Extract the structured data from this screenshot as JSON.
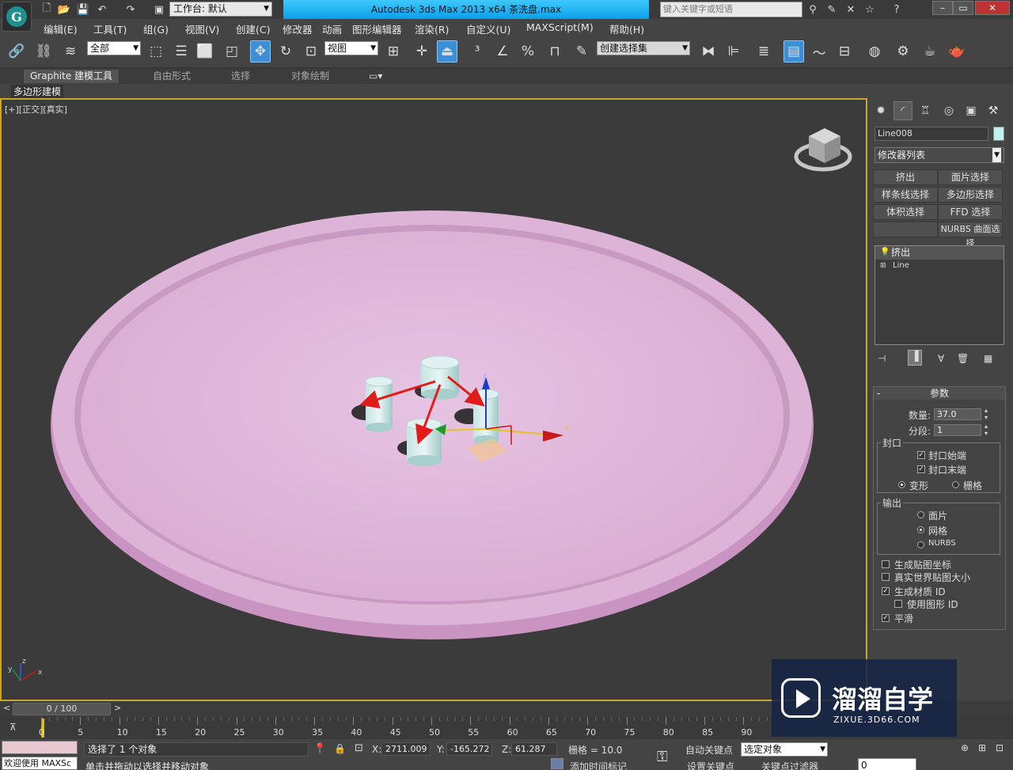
{
  "titlebar": {
    "workspace": "工作台: 默认",
    "app_title": "Autodesk 3ds Max  2013 x64      茶洗盘.max",
    "search_placeholder": "键入关键字或短语"
  },
  "menu": [
    "编辑(E)",
    "工具(T)",
    "组(G)",
    "视图(V)",
    "创建(C)",
    "修改器",
    "动画",
    "图形编辑器",
    "渲染(R)",
    "自定义(U)",
    "MAXScript(M)",
    "帮助(H)"
  ],
  "toolbar": {
    "selection_filter": "全部",
    "ref_coord": "视图",
    "named_selection": "创建选择集"
  },
  "ribbon": {
    "tabs": [
      "Graphite 建模工具",
      "自由形式",
      "选择",
      "对象绘制"
    ],
    "panel": "多边形建模"
  },
  "viewport": {
    "label": "[+][正交][真实]",
    "axis_labels": [
      "x",
      "y",
      "z"
    ]
  },
  "command_panel": {
    "object_name": "Line008",
    "object_color": "#bff2ee",
    "modifier_list": "修改器列表",
    "mod_buttons": [
      "挤出",
      "面片选择",
      "样条线选择",
      "多边形选择",
      "体积选择",
      "FFD 选择",
      "",
      "NURBS 曲面选择"
    ],
    "stack": [
      {
        "label": "挤出",
        "selected": true
      },
      {
        "label": "Line",
        "selected": false
      }
    ],
    "params": {
      "rollout_title": "参数",
      "amount_label": "数量:",
      "amount_value": "37.0",
      "segments_label": "分段:",
      "segments_value": "1",
      "capping_title": "封口",
      "cap_start": "封口始端",
      "cap_end": "封口末端",
      "morph": "变形",
      "grid": "栅格",
      "output_title": "输出",
      "patch": "面片",
      "mesh": "网格",
      "nurbs": "NURBS",
      "gen_mapping": "生成贴图坐标",
      "real_world": "真实世界贴图大小",
      "gen_mat_ids": "生成材质 ID",
      "use_shape_ids": "使用图形 ID",
      "smooth": "平滑"
    }
  },
  "timeline": {
    "frame_display": "0 / 100",
    "ticks": [
      "0",
      "5",
      "10",
      "15",
      "20",
      "25",
      "30",
      "35",
      "40",
      "45",
      "50",
      "55",
      "60",
      "65",
      "70",
      "75",
      "80",
      "85",
      "90"
    ]
  },
  "status": {
    "maxscript_listener": "欢迎使用 MAXSc",
    "prompt": "选择了 1 个对象",
    "hint": "单击并拖动以选择并移动对象",
    "x_label": "X:",
    "x_value": "2711.009",
    "y_label": "Y:",
    "y_value": "-165.272",
    "z_label": "Z:",
    "z_value": "61.287",
    "grid": "栅格 = 10.0",
    "auto_key": "自动关键点",
    "set_key": "设置关键点",
    "key_mode": "选定对象",
    "key_filters": "关键点过滤器",
    "add_time_tag": "添加时间标记",
    "frame": "0"
  },
  "watermark": {
    "brand": "溜溜自学",
    "url": "ZIXUE.3D66.COM"
  }
}
